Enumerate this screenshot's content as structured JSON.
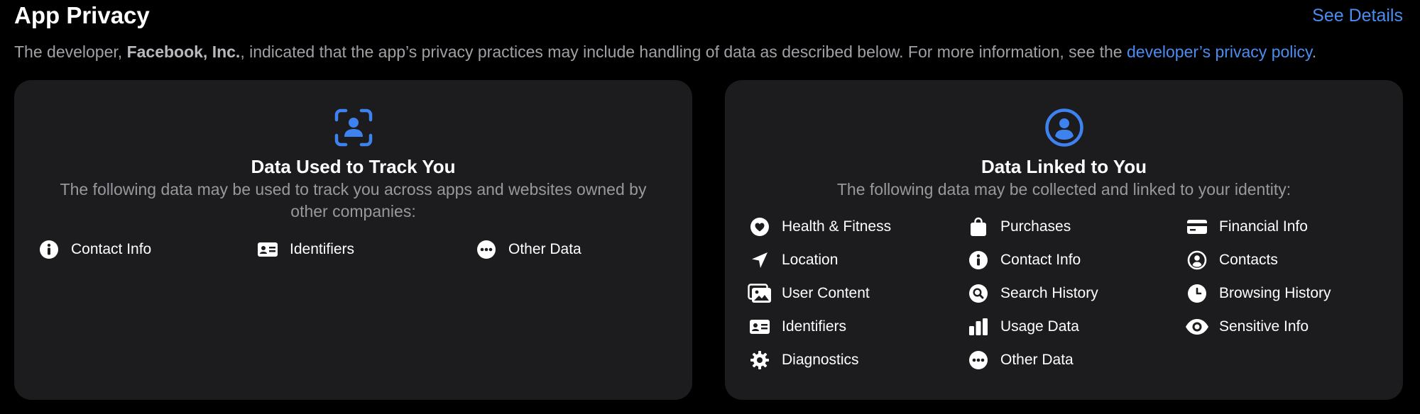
{
  "header": {
    "title": "App Privacy",
    "see_details": "See Details"
  },
  "description": {
    "prefix": "The developer, ",
    "developer": "Facebook, Inc.",
    "middle": ", indicated that the app’s privacy practices may include handling of data as described below. For more information, see the ",
    "link": "developer’s privacy policy",
    "suffix": "."
  },
  "colors": {
    "accent": "#4a8cf0",
    "background": "#000000",
    "card": "#1c1c1e"
  },
  "track_card": {
    "icon": "person-viewfinder-icon",
    "title": "Data Used to Track You",
    "subtitle": "The following data may be used to track you across apps and websites owned by other companies:",
    "items": [
      {
        "label": "Contact Info",
        "icon": "info-icon"
      },
      {
        "label": "Identifiers",
        "icon": "id-card-icon"
      },
      {
        "label": "Other Data",
        "icon": "more-icon"
      }
    ]
  },
  "linked_card": {
    "icon": "person-circle-icon",
    "title": "Data Linked to You",
    "subtitle": "The following data may be collected and linked to your identity:",
    "items": [
      {
        "label": "Health & Fitness",
        "icon": "heart-icon"
      },
      {
        "label": "Purchases",
        "icon": "shopping-bag-icon"
      },
      {
        "label": "Financial Info",
        "icon": "credit-card-icon"
      },
      {
        "label": "Location",
        "icon": "location-arrow-icon"
      },
      {
        "label": "Contact Info",
        "icon": "info-icon"
      },
      {
        "label": "Contacts",
        "icon": "person-circle-icon"
      },
      {
        "label": "User Content",
        "icon": "photos-icon"
      },
      {
        "label": "Search History",
        "icon": "magnifier-icon"
      },
      {
        "label": "Browsing History",
        "icon": "clock-icon"
      },
      {
        "label": "Identifiers",
        "icon": "id-card-icon"
      },
      {
        "label": "Usage Data",
        "icon": "bar-chart-icon"
      },
      {
        "label": "Sensitive Info",
        "icon": "eye-icon"
      },
      {
        "label": "Diagnostics",
        "icon": "gear-icon"
      },
      {
        "label": "Other Data",
        "icon": "more-icon"
      }
    ]
  }
}
